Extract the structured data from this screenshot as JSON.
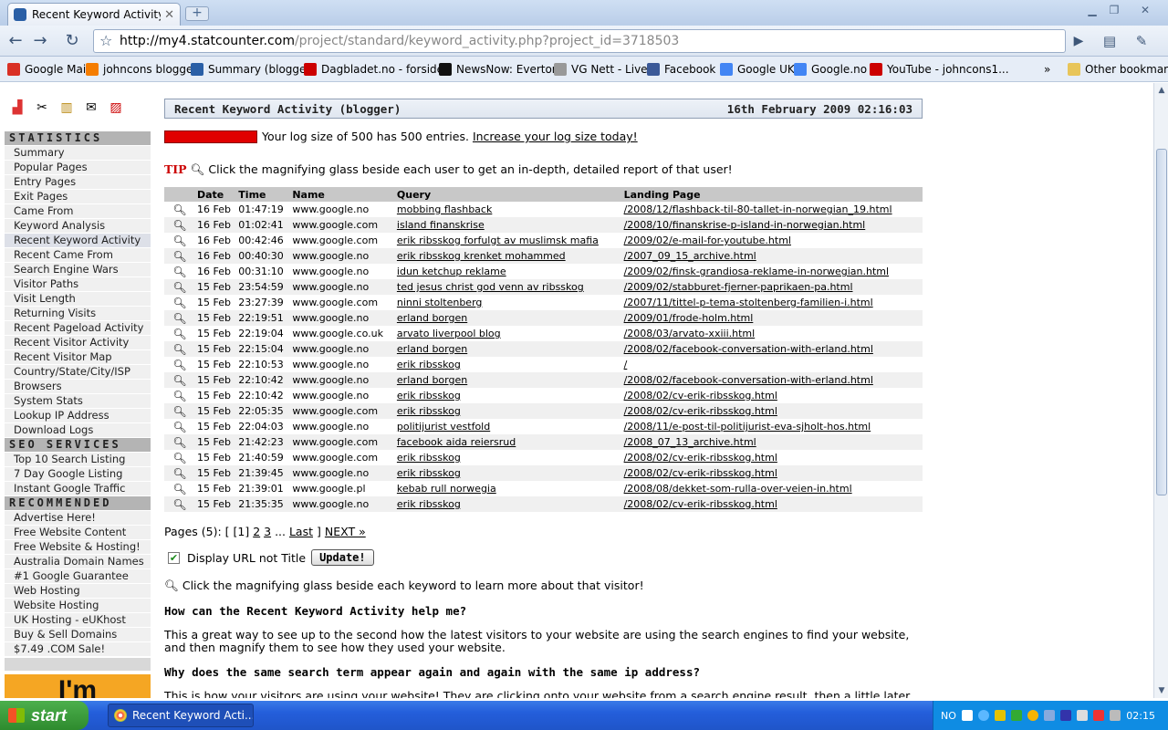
{
  "browser": {
    "tab_title": "Recent Keyword Activity (...",
    "tab_close": "✕",
    "url_host": "http://my4.statcounter.com",
    "url_path": "/project/standard/keyword_activity.php?project_id=3718503",
    "bookmarks": [
      {
        "label": "Google Mail",
        "color": "#d93025"
      },
      {
        "label": "johncons blogger",
        "color": "#f57d00"
      },
      {
        "label": "Summary (blogger)",
        "color": "#2a5fa6"
      },
      {
        "label": "Dagbladet.no - forsiden",
        "color": "#cc0000"
      },
      {
        "label": "NewsNow: Everton",
        "color": "#111111"
      },
      {
        "label": "VG Nett - Live!",
        "color": "#999999"
      },
      {
        "label": "Facebook",
        "color": "#3b5998"
      },
      {
        "label": "Google UK",
        "color": "#4285f4"
      },
      {
        "label": "Google.no",
        "color": "#4285f4"
      },
      {
        "label": "YouTube - johncons1...",
        "color": "#cc0000"
      }
    ],
    "overflow": "»",
    "other_bookmarks": "Other bookmarks"
  },
  "sidebar": {
    "sections": [
      {
        "title": "STATISTICS",
        "items": [
          "Summary",
          "Popular Pages",
          "Entry Pages",
          "Exit Pages",
          "Came From",
          "Keyword Analysis",
          "Recent Keyword Activity",
          "Recent Came From",
          "Search Engine Wars",
          "Visitor Paths",
          "Visit Length",
          "Returning Visits",
          "Recent Pageload Activity",
          "Recent Visitor Activity",
          "Recent Visitor Map",
          "Country/State/City/ISP",
          "Browsers",
          "System Stats",
          "Lookup IP Address",
          "Download Logs"
        ]
      },
      {
        "title": "SEO SERVICES",
        "items": [
          "Top 10 Search Listing",
          "7 Day Google Listing",
          "Instant Google Traffic"
        ]
      },
      {
        "title": "RECOMMENDED",
        "items": [
          "Advertise Here!",
          "Free Website Content",
          "Free Website & Hosting!",
          "Australia Domain Names",
          "#1 Google Guarantee",
          "Web Hosting",
          "Website Hosting",
          "UK Hosting - eUKhost",
          "Buy & Sell Domains",
          "$7.49 .COM Sale!"
        ]
      }
    ],
    "active": "Recent Keyword Activity",
    "ad_text": "I'm"
  },
  "main": {
    "title": "Recent Keyword Activity (blogger)",
    "datetime": "16th February 2009 02:16:03",
    "log_text": "Your log size of 500 has 500 entries.",
    "log_link": "Increase your log size today!",
    "tip_word": "TIP",
    "tip_text": "Click the magnifying glass beside each user to get an in-depth, detailed report of that user!",
    "columns": [
      "Date",
      "Time",
      "Name",
      "Query",
      "Landing Page"
    ],
    "rows": [
      [
        "16 Feb",
        "01:47:19",
        "www.google.no",
        "mobbing flashback",
        "/2008/12/flashback-til-80-tallet-in-norwegian_19.html"
      ],
      [
        "16 Feb",
        "01:02:41",
        "www.google.com",
        "island finanskrise",
        "/2008/10/finanskrise-p-island-in-norwegian.html"
      ],
      [
        "16 Feb",
        "00:42:46",
        "www.google.com",
        "erik ribsskog forfulgt av muslimsk mafia",
        "/2009/02/e-mail-for-youtube.html"
      ],
      [
        "16 Feb",
        "00:40:30",
        "www.google.no",
        "erik ribsskog krenket mohammed",
        "/2007_09_15_archive.html"
      ],
      [
        "16 Feb",
        "00:31:10",
        "www.google.no",
        "idun ketchup reklame",
        "/2009/02/finsk-grandiosa-reklame-in-norwegian.html"
      ],
      [
        "15 Feb",
        "23:54:59",
        "www.google.no",
        "ted jesus christ god venn av ribsskog",
        "/2009/02/stabburet-fjerner-paprikaen-pa.html"
      ],
      [
        "15 Feb",
        "23:27:39",
        "www.google.com",
        "ninni stoltenberg",
        "/2007/11/tittel-p-tema-stoltenberg-familien-i.html"
      ],
      [
        "15 Feb",
        "22:19:51",
        "www.google.no",
        "erland borgen",
        "/2009/01/frode-holm.html"
      ],
      [
        "15 Feb",
        "22:19:04",
        "www.google.co.uk",
        "arvato liverpool blog",
        "/2008/03/arvato-xxiii.html"
      ],
      [
        "15 Feb",
        "22:15:04",
        "www.google.no",
        "erland borgen",
        "/2008/02/facebook-conversation-with-erland.html"
      ],
      [
        "15 Feb",
        "22:10:53",
        "www.google.no",
        "erik ribsskog",
        "/"
      ],
      [
        "15 Feb",
        "22:10:42",
        "www.google.no",
        "erland borgen",
        "/2008/02/facebook-conversation-with-erland.html"
      ],
      [
        "15 Feb",
        "22:10:42",
        "www.google.no",
        "erik ribsskog",
        "/2008/02/cv-erik-ribsskog.html"
      ],
      [
        "15 Feb",
        "22:05:35",
        "www.google.com",
        "erik ribsskog",
        "/2008/02/cv-erik-ribsskog.html"
      ],
      [
        "15 Feb",
        "22:04:03",
        "www.google.no",
        "politijurist vestfold",
        "/2008/11/e-post-til-politijurist-eva-sjholt-hos.html"
      ],
      [
        "15 Feb",
        "21:42:23",
        "www.google.com",
        "facebook aida reiersrud",
        "/2008_07_13_archive.html"
      ],
      [
        "15 Feb",
        "21:40:59",
        "www.google.com",
        "erik ribsskog",
        "/2008/02/cv-erik-ribsskog.html"
      ],
      [
        "15 Feb",
        "21:39:45",
        "www.google.no",
        "erik ribsskog",
        "/2008/02/cv-erik-ribsskog.html"
      ],
      [
        "15 Feb",
        "21:39:01",
        "www.google.pl",
        "kebab rull norwegia",
        "/2008/08/dekket-som-rulla-over-veien-in.html"
      ],
      [
        "15 Feb",
        "21:35:35",
        "www.google.no",
        "erik ribsskog",
        "/2008/02/cv-erik-ribsskog.html"
      ]
    ],
    "pages_prefix": "Pages (5): [ [1]",
    "page2": "2",
    "page3": "3",
    "ellipsis": "...",
    "last": "Last",
    "pages_close": "]",
    "next": "NEXT »",
    "display_label": "Display URL not Title",
    "update": "Update!",
    "mg_note": "Click the magnifying glass beside each keyword to learn more about that visitor!",
    "h1": "How can the Recent Keyword Activity help me?",
    "p1": "This a great way to see up to the second how the latest visitors to your website are using the search engines to find your website, and then magnify them to see how they used your website.",
    "h2": "Why does the same search term appear again and again with the same ip address?",
    "p2": "This is how your visitors are using your website! They are clicking onto your website from a search engine result, then a little later"
  },
  "taskbar": {
    "start": "start",
    "window": "Recent Keyword Acti...",
    "lang": "NO",
    "clock": "02:15"
  }
}
